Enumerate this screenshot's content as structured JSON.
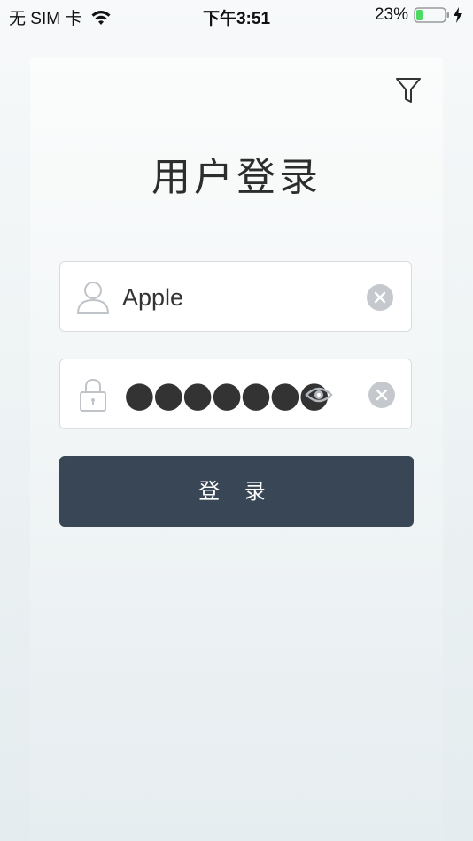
{
  "status_bar": {
    "carrier": "无 SIM 卡",
    "time": "下午3:51",
    "battery_percent": "23%",
    "battery_level": 0.23,
    "icons": [
      "wifi-icon",
      "battery-icon",
      "charging-icon"
    ]
  },
  "header": {
    "filter_icon": "filter-icon"
  },
  "login": {
    "title": "用户登录",
    "username": {
      "value": "Apple",
      "icon": "user-icon",
      "clear_icon": "clear-icon"
    },
    "password": {
      "masked_value": "●●●●●●●",
      "icon": "lock-icon",
      "toggle_icon": "eye-icon",
      "clear_icon": "clear-icon"
    },
    "submit_label": "登 录"
  },
  "colors": {
    "button_bg": "#394655",
    "button_text": "#ffffff",
    "clear_bg": "#c5c9ce",
    "icon_gray": "#c0c4c9",
    "battery_fill": "#4cd964"
  }
}
